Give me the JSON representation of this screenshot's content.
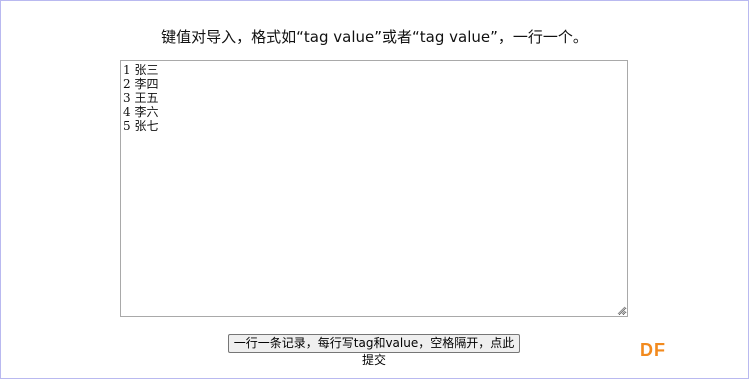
{
  "instruction": "键值对导入，格式如“tag value”或者“tag value”，一行一个。",
  "textarea": {
    "lines": [
      "1 张三",
      "2 李四",
      "3 王五",
      "4 李六",
      "5 张七"
    ]
  },
  "submit_button": {
    "label": "一行一条记录，每行写tag和value，空格隔开，点此提交"
  },
  "watermark": {
    "text": "DF",
    "color": "#f28a1e"
  }
}
